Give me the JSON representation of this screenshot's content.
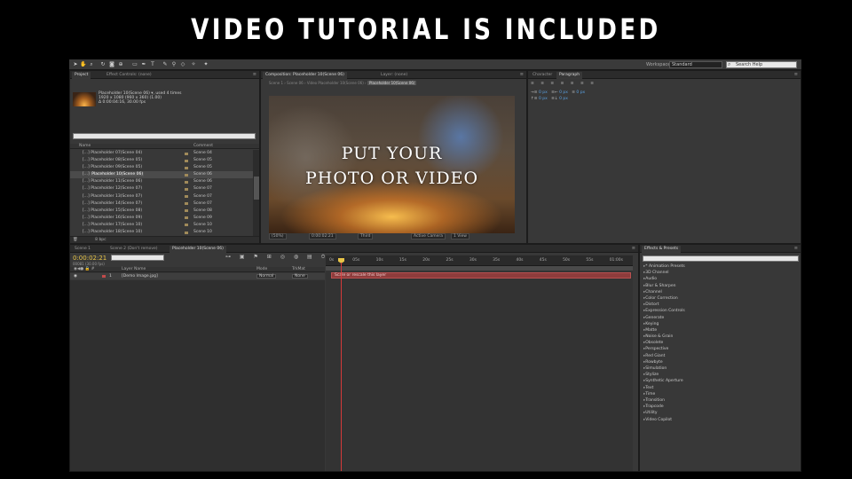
{
  "banner": {
    "title": "VIDEO TUTORIAL IS INCLUDED"
  },
  "toolbar": {
    "tools": [
      "select-arrow",
      "hand",
      "zoom",
      "rotate",
      "camera",
      "pan-behind",
      "pen",
      "text",
      "brush",
      "clone",
      "eraser",
      "roto",
      "puppet"
    ],
    "workspace_label": "Workspace:",
    "workspace_value": "Standard",
    "help_placeholder": "Search Help"
  },
  "project_panel": {
    "tabs": [
      "Project",
      "Effect Controls: (none)"
    ],
    "selected_name": "Placeholder 10(Scene 06) ▾, used 4 times",
    "selected_res": "1920 x 1080 (960 x 360) (1.00)",
    "selected_dur": "Δ 0:00:04:16, 30.00 fps",
    "search_value": "",
    "col_name": "Name",
    "col_comment": "Comment",
    "rows": [
      {
        "name": "Placeholder 07(Scene 04)",
        "comment": "Scene 04",
        "selected": false
      },
      {
        "name": "Placeholder 08(Scene 05)",
        "comment": "Scene 05",
        "selected": false
      },
      {
        "name": "Placeholder 09(Scene 05)",
        "comment": "Scene 05",
        "selected": false
      },
      {
        "name": "Placeholder 10(Scene 06)",
        "comment": "Scene 06",
        "selected": true
      },
      {
        "name": "Placeholder 11(Scene 06)",
        "comment": "Scene 06",
        "selected": false
      },
      {
        "name": "Placeholder 12(Scene 07)",
        "comment": "Scene 07",
        "selected": false
      },
      {
        "name": "Placeholder 13(Scene 07)",
        "comment": "Scene 07",
        "selected": false
      },
      {
        "name": "Placeholder 14(Scene 07)",
        "comment": "Scene 07",
        "selected": false
      },
      {
        "name": "Placeholder 15(Scene 08)",
        "comment": "Scene 08",
        "selected": false
      },
      {
        "name": "Placeholder 16(Scene 09)",
        "comment": "Scene 09",
        "selected": false
      },
      {
        "name": "Placeholder 17(Scene 10)",
        "comment": "Scene 10",
        "selected": false
      },
      {
        "name": "Placeholder 18(Scene 10)",
        "comment": "Scene 10",
        "selected": false
      },
      {
        "name": "Placeholder 19(Scene 11)",
        "comment": "Scene 11",
        "selected": false
      },
      {
        "name": "Placeholder 20(Scene 11)",
        "comment": "Scene 11",
        "selected": false
      }
    ],
    "footer_bpc": "8 bpc"
  },
  "comp_panel": {
    "tabs": [
      "Composition: Placeholder 10(Scene 06)",
      "Layer: (none)"
    ],
    "breadcrumb": [
      "Scene 1",
      "Scene 06",
      "Video Placeholder 10(Scene 06)",
      "Placeholder 10(Scene 06)"
    ],
    "viewer_line1": "PUT YOUR",
    "viewer_line2": "PHOTO OR VIDEO",
    "zoom": "(50%)",
    "timecode": "0:00:02:21",
    "resolution": "Third",
    "camera": "Active Camera",
    "views": "1 View"
  },
  "paragraph_panel": {
    "tabs": [
      "Character",
      "Paragraph"
    ],
    "indent_left": "0 px",
    "indent_right": "0 px",
    "space_before": "0 px",
    "space_after": "0 px",
    "first_line": "0 px"
  },
  "timeline": {
    "tabs": [
      "Scene 1",
      "Scene 2 (Don't remove)",
      "Placeholder 10(Scene 06)"
    ],
    "current_time": "0:00:02:21",
    "time_sub": "00081 (30.00 fps)",
    "search_value": "",
    "col_layer": "Layer Name",
    "col_mode": "Mode",
    "col_trkmat": "TrkMat",
    "layer_index": "1",
    "layer_name": "[Demo Image.jpg]",
    "layer_mode": "Normal",
    "layer_trkmat": "None",
    "track_label": "Scale or rescale this layer",
    "ruler_ticks": [
      "0s",
      "05s",
      "10s",
      "15s",
      "20s",
      "25s",
      "30s",
      "35s",
      "40s",
      "45s",
      "50s",
      "55s",
      "01:00s"
    ]
  },
  "effects_panel": {
    "tabs": [
      "Effects & Presets"
    ],
    "search_value": "",
    "items": [
      "* Animation Presets",
      "3D Channel",
      "Audio",
      "Blur & Sharpen",
      "Channel",
      "Color Correction",
      "Distort",
      "Expression Controls",
      "Generate",
      "Keying",
      "Matte",
      "Noise & Grain",
      "Obsolete",
      "Perspective",
      "Red Giant",
      "Rowbyte",
      "Simulation",
      "Stylize",
      "Synthetic Aperture",
      "Text",
      "Time",
      "Transition",
      "Trapcode",
      "Utility",
      "Video Copilot"
    ]
  },
  "colors": {
    "panel_bg": "#383838",
    "timecode": "#e8c548",
    "playhead": "#d43a3a",
    "track_bar": "#8e3c3c",
    "label_swatch": "#a08a5a"
  }
}
